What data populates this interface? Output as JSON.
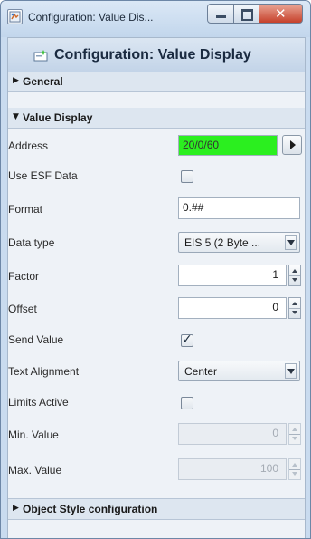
{
  "window": {
    "title": "Configuration: Value Dis...",
    "close_glyph": "✕",
    "icon": "app-window-icon"
  },
  "panel": {
    "header_title": "Configuration: Value Display",
    "header_icon": "edit-sparkle-icon"
  },
  "sections": {
    "general": "General",
    "value_display": "Value Display",
    "object_style": "Object Style configuration"
  },
  "properties": {
    "address": {
      "label": "Address",
      "value": "20/0/60",
      "bg_color": "#2bef1f"
    },
    "use_esf": {
      "label": "Use ESF Data",
      "checked": false
    },
    "format": {
      "label": "Format",
      "value": "0.##"
    },
    "data_type": {
      "label": "Data type",
      "value": "EIS 5 (2 Byte ..."
    },
    "factor": {
      "label": "Factor",
      "value": "1"
    },
    "offset": {
      "label": "Offset",
      "value": "0"
    },
    "send_value": {
      "label": "Send Value",
      "checked": true,
      "check_glyph": "✓"
    },
    "text_alignment": {
      "label": "Text Alignment",
      "value": "Center"
    },
    "limits_active": {
      "label": "Limits Active",
      "checked": false
    },
    "min_value": {
      "label": "Min. Value",
      "value": "0"
    },
    "max_value": {
      "label": "Max. Value",
      "value": "100"
    }
  },
  "colors": {
    "titlebar": "#c9dbef",
    "panel_bg": "#eef2f7",
    "address_highlight": "#2bef1f"
  }
}
